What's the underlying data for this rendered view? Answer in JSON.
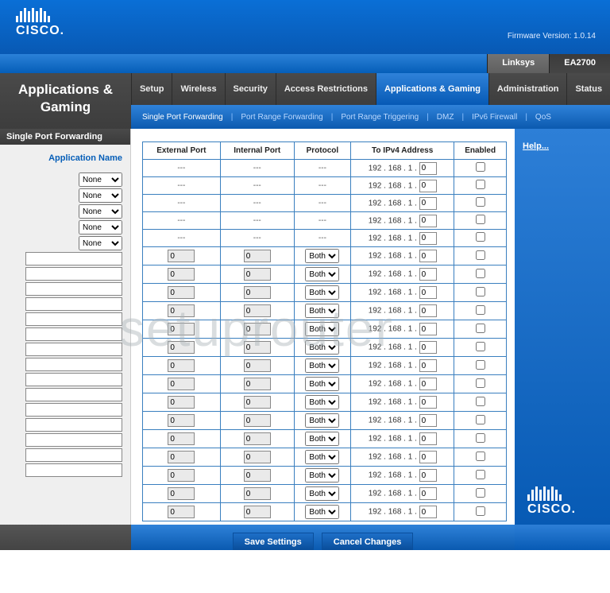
{
  "header": {
    "logo_text": "CISCO.",
    "firmware": "Firmware Version: 1.0.14",
    "brand": "Linksys",
    "model": "EA2700"
  },
  "page_title": "Applications & Gaming",
  "tabs": [
    {
      "label": "Setup",
      "active": false
    },
    {
      "label": "Wireless",
      "active": false
    },
    {
      "label": "Security",
      "active": false
    },
    {
      "label": "Access Restrictions",
      "active": false
    },
    {
      "label": "Applications & Gaming",
      "active": true
    },
    {
      "label": "Administration",
      "active": false
    },
    {
      "label": "Status",
      "active": false
    }
  ],
  "subnav": [
    {
      "label": "Single Port Forwarding",
      "active": true
    },
    {
      "label": "Port Range Forwarding",
      "active": false
    },
    {
      "label": "Port Range Triggering",
      "active": false
    },
    {
      "label": "DMZ",
      "active": false
    },
    {
      "label": "IPv6 Firewall",
      "active": false
    },
    {
      "label": "QoS",
      "active": false
    }
  ],
  "sidebar": {
    "section_title": "Single Port Forwarding",
    "app_name_label": "Application Name",
    "preset_rows": [
      "None",
      "None",
      "None",
      "None",
      "None"
    ],
    "custom_rows_count": 15
  },
  "table": {
    "headers": {
      "ext": "External Port",
      "int": "Internal Port",
      "proto": "Protocol",
      "ip": "To IPv4 Address",
      "enabled": "Enabled"
    },
    "dash": "---",
    "ip_prefix": [
      "192",
      "168",
      "1"
    ],
    "preset_rows": [
      {
        "ext": "---",
        "int": "---",
        "proto": "---",
        "ip_last": "0",
        "enabled": false
      },
      {
        "ext": "---",
        "int": "---",
        "proto": "---",
        "ip_last": "0",
        "enabled": false
      },
      {
        "ext": "---",
        "int": "---",
        "proto": "---",
        "ip_last": "0",
        "enabled": false
      },
      {
        "ext": "---",
        "int": "---",
        "proto": "---",
        "ip_last": "0",
        "enabled": false
      },
      {
        "ext": "---",
        "int": "---",
        "proto": "---",
        "ip_last": "0",
        "enabled": false
      }
    ],
    "custom_rows": [
      {
        "ext": "0",
        "int": "0",
        "proto": "Both",
        "ip_last": "0",
        "enabled": false
      },
      {
        "ext": "0",
        "int": "0",
        "proto": "Both",
        "ip_last": "0",
        "enabled": false
      },
      {
        "ext": "0",
        "int": "0",
        "proto": "Both",
        "ip_last": "0",
        "enabled": false
      },
      {
        "ext": "0",
        "int": "0",
        "proto": "Both",
        "ip_last": "0",
        "enabled": false
      },
      {
        "ext": "0",
        "int": "0",
        "proto": "Both",
        "ip_last": "0",
        "enabled": false
      },
      {
        "ext": "0",
        "int": "0",
        "proto": "Both",
        "ip_last": "0",
        "enabled": false
      },
      {
        "ext": "0",
        "int": "0",
        "proto": "Both",
        "ip_last": "0",
        "enabled": false
      },
      {
        "ext": "0",
        "int": "0",
        "proto": "Both",
        "ip_last": "0",
        "enabled": false
      },
      {
        "ext": "0",
        "int": "0",
        "proto": "Both",
        "ip_last": "0",
        "enabled": false
      },
      {
        "ext": "0",
        "int": "0",
        "proto": "Both",
        "ip_last": "0",
        "enabled": false
      },
      {
        "ext": "0",
        "int": "0",
        "proto": "Both",
        "ip_last": "0",
        "enabled": false
      },
      {
        "ext": "0",
        "int": "0",
        "proto": "Both",
        "ip_last": "0",
        "enabled": false
      },
      {
        "ext": "0",
        "int": "0",
        "proto": "Both",
        "ip_last": "0",
        "enabled": false
      },
      {
        "ext": "0",
        "int": "0",
        "proto": "Both",
        "ip_last": "0",
        "enabled": false
      },
      {
        "ext": "0",
        "int": "0",
        "proto": "Both",
        "ip_last": "0",
        "enabled": false
      }
    ]
  },
  "help": {
    "link_label": "Help..."
  },
  "buttons": {
    "save": "Save Settings",
    "cancel": "Cancel Changes"
  },
  "watermark": "setuprouter"
}
